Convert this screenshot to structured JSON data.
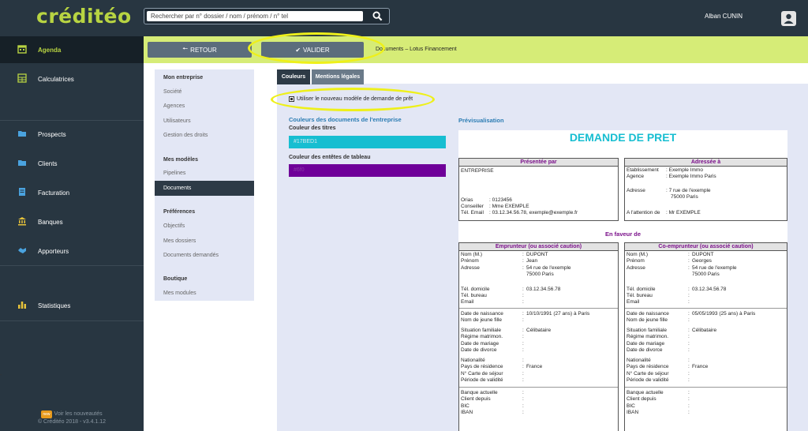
{
  "app": {
    "logo": "créditéo",
    "user_name": "Alban CUNIN",
    "accent": "#b8d442"
  },
  "search": {
    "placeholder": "Rechercher par n° dossier / nom / prénom / n° tel"
  },
  "sidebar": {
    "items": [
      {
        "label": "Agenda",
        "icon": "calendar-icon"
      },
      {
        "label": "Calculatrices",
        "icon": "calculator-icon"
      },
      {
        "label": "Prospects",
        "icon": "folder-icon"
      },
      {
        "label": "Clients",
        "icon": "folder-icon"
      },
      {
        "label": "Facturation",
        "icon": "invoice-icon"
      },
      {
        "label": "Banques",
        "icon": "bank-icon"
      },
      {
        "label": "Apporteurs",
        "icon": "handshake-icon"
      },
      {
        "label": "Statistiques",
        "icon": "bar-chart-icon"
      }
    ],
    "footer_news_badge": "new",
    "footer_news": "Voir les nouveautés",
    "footer_version": "© Créditéo 2018 - v3.4.1.12"
  },
  "toolbar": {
    "back_label": "RETOUR",
    "validate_label": "VALIDER",
    "breadcrumb": "Documents – Lotus Financement"
  },
  "left_menu": {
    "section1": "Mon entreprise",
    "section1_items": [
      "Société",
      "Agences",
      "Utilisateurs",
      "Gestion des droits"
    ],
    "section2": "Mes modèles",
    "section2_items": [
      "Pipelines",
      "Documents"
    ],
    "section3": "Préférences",
    "section3_items": [
      "Objectifs",
      "Mes dossiers",
      "Documents demandés"
    ],
    "section4": "Boutique",
    "section4_items": [
      "Mes modules"
    ]
  },
  "tabs": {
    "colors": "Couleurs",
    "legal": "Mentions légales"
  },
  "settings": {
    "checkbox_label": "Utiliser le nouveau modèle de demande de prêt",
    "colors_section": "Couleurs des documents de l'entreprise",
    "title_color_label": "Couleur des titres",
    "title_color_value": "#17BED1",
    "header_color_label": "Couleur des entêtes de tableau",
    "header_color_value": "#6f0",
    "title_color_swatch": "#17bed1",
    "header_color_swatch": "#6f0099"
  },
  "preview": {
    "section_title": "Prévisualisation",
    "doc_title": "DEMANDE DE PRET",
    "presented_by": {
      "header": "Présentée par",
      "company": "ENTREPRISE",
      "orias_label": "Orias",
      "orias_value": ": 0123456",
      "advisor_label": "Conseiller",
      "advisor_value": ": Mme EXEMPLE",
      "contact_label": "Tél. Email",
      "contact_value": ": 03.12.34.56.78, exemple@exemple.fr"
    },
    "addressed_to": {
      "header": "Adressée à",
      "establishment_label": "Etablissement",
      "establishment_value": ": Exemple Immo",
      "agency_label": "Agence",
      "agency_value": ": Exemple Immo Paris",
      "address_label": "Adresse",
      "address_line1": ": 7 rue de l'exemple",
      "address_line2": "75000 Paris",
      "attention_label": "A l'attention de",
      "attention_value": ": Mr EXEMPLE"
    },
    "in_favor": "En faveur de",
    "borrower": {
      "header": "Emprunteur (ou associé caution)",
      "name_label": "Nom (M.)",
      "name": "DUPONT",
      "first_label": "Prénom",
      "first": "Jean",
      "addr_label": "Adresse",
      "addr1": "54 rue de l'exemple",
      "addr2": "75000 Paris",
      "home_tel_label": "Tél. domicile",
      "home_tel": "03.12.34.56.78",
      "office_tel_label": "Tél. bureau",
      "email_label": "Email",
      "birth_label": "Date de naissance",
      "birth": "10/10/1991 (27 ans) à Paris",
      "maiden_label": "Nom de jeune fille",
      "family_label": "Situation familiale",
      "family": "Célibataire",
      "regime_label": "Régime matrimon.",
      "marriage_label": "Date de mariage",
      "divorce_label": "Date de divorce",
      "nationality_label": "Nationalité",
      "country_label": "Pays de résidence",
      "country": "France",
      "permit_label": "N° Carte de séjour",
      "validity_label": "Période de validité",
      "bank_label": "Banque actuelle",
      "client_since_label": "Client depuis",
      "bic_label": "BIC",
      "iban_label": "IBAN"
    },
    "coborrower": {
      "header": "Co-emprunteur (ou associé caution)",
      "name_label": "Nom (M.)",
      "name": "DUPONT",
      "first_label": "Prénom",
      "first": "Georges",
      "addr_label": "Adresse",
      "addr1": "54 rue de l'exemple",
      "addr2": "75000 Paris",
      "home_tel_label": "Tél. domicile",
      "home_tel": "03.12.34.56.78",
      "office_tel_label": "Tél. bureau",
      "email_label": "Email",
      "birth_label": "Date de naissance",
      "birth": "05/05/1993 (25 ans) à Paris",
      "maiden_label": "Nom de jeune fille",
      "family_label": "Situation familiale",
      "family": "Célibataire",
      "regime_label": "Régime matrimon.",
      "marriage_label": "Date de mariage",
      "divorce_label": "Date de divorce",
      "nationality_label": "Nationalité",
      "country_label": "Pays de résidence",
      "country": "France",
      "permit_label": "N° Carte de séjour",
      "validity_label": "Période de validité",
      "bank_label": "Banque actuelle",
      "client_since_label": "Client depuis",
      "bic_label": "BIC",
      "iban_label": "IBAN"
    }
  }
}
